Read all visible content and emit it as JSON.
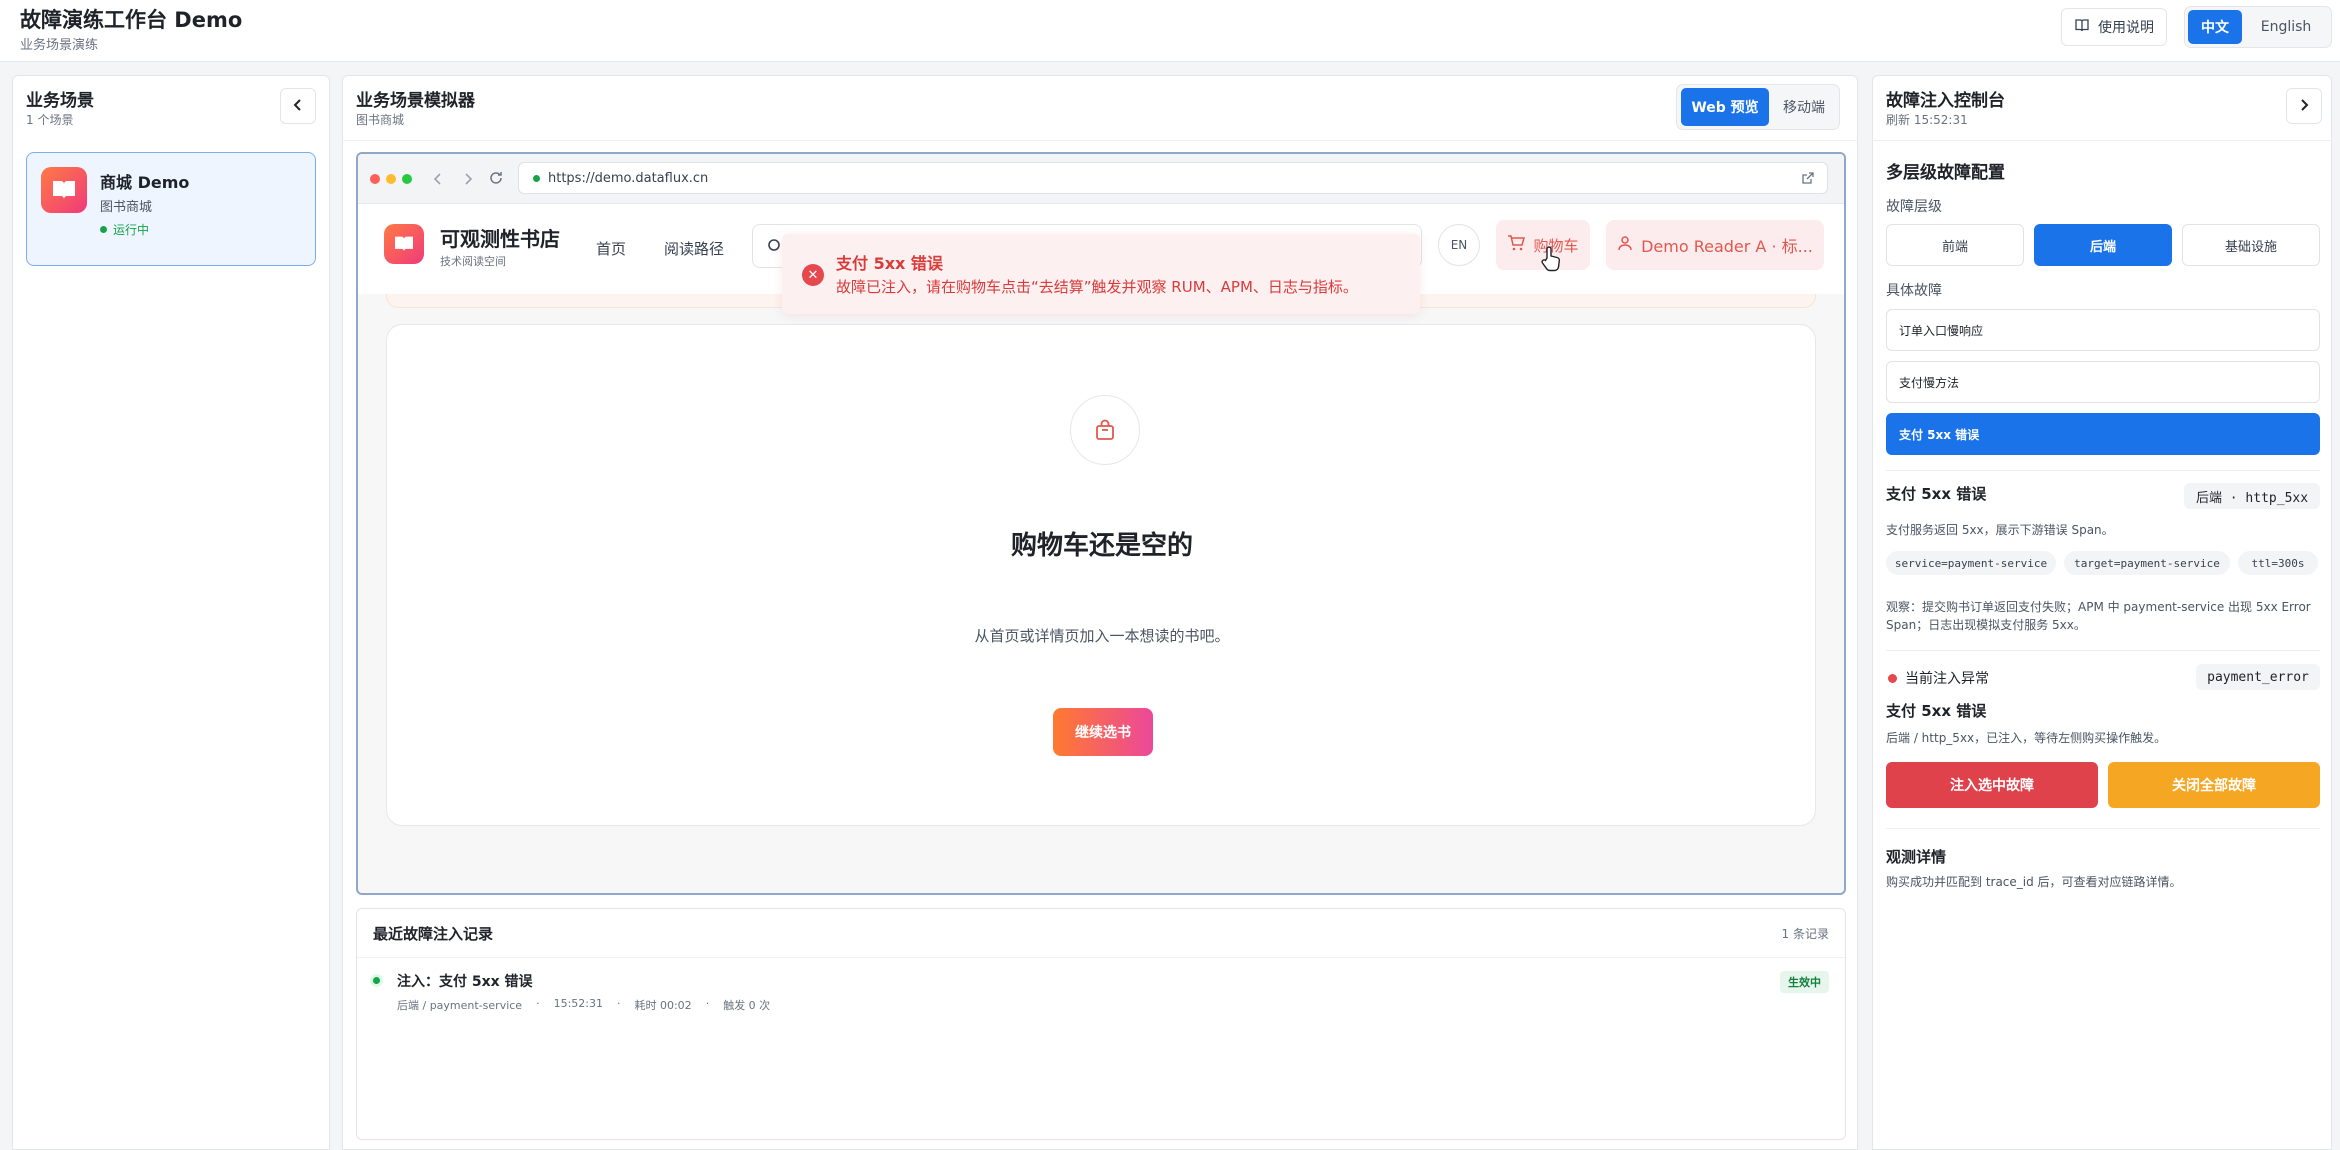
{
  "header": {
    "title": "故障演练工作台 Demo",
    "subtitle": "业务场景演练",
    "help_label": "使用说明",
    "lang_zh": "中文",
    "lang_en": "English"
  },
  "sidebar": {
    "title": "业务场景",
    "count": "1 个场景",
    "scenes": [
      {
        "name": "商城 Demo",
        "type": "图书商城",
        "status": "运行中",
        "status_color": "#16a34a"
      }
    ]
  },
  "simulator": {
    "title": "业务场景模拟器",
    "subtitle": "图书商城",
    "modes": [
      "Web 预览",
      "移动端"
    ],
    "url": "https://demo.dataflux.cn",
    "site": {
      "name": "可观测性书店",
      "tagline": "技术阅读空间",
      "nav": [
        "首页",
        "阅读路径"
      ],
      "lang_btn": "EN",
      "cart_label": "购物车",
      "user_label": "Demo Reader A · 标..."
    },
    "toast": {
      "title": "支付 5xx 错误",
      "message": "故障已注入，请在购物车点击“去结算”触发并观察 RUM、APM、日志与指标。"
    },
    "cart": {
      "empty_title": "购物车还是空的",
      "empty_sub": "从首页或详情页加入一本想读的书吧。",
      "continue_label": "继续选书"
    }
  },
  "records": {
    "title": "最近故障注入记录",
    "count": "1 条记录",
    "items": [
      {
        "name": "注入：支付 5xx 错误",
        "meta": [
          "后端 / payment-service",
          "·",
          "15:52:31",
          "·",
          "耗时 00:02",
          "·",
          "触发 0 次"
        ],
        "badge": "生效中"
      }
    ]
  },
  "console": {
    "title": "故障注入控制台",
    "refresh": "刷新 15:52:31",
    "config_title": "多层级故障配置",
    "layer_label": "故障层级",
    "layers": [
      "前端",
      "后端",
      "基础设施"
    ],
    "faults_label": "具体故障",
    "faults": [
      "订单入口慢响应",
      "支付慢方法",
      "支付 5xx 错误"
    ],
    "detail": {
      "name": "支付 5xx 错误",
      "code": "后端 · http_5xx",
      "desc": "支付服务返回 5xx，展示下游错误 Span。",
      "chips": [
        "service=payment-service",
        "target=payment-service",
        "ttl=300s"
      ],
      "observe": "观察：提交购书订单返回支付失败；APM 中 payment-service 出现 5xx Error Span；日志出现模拟支付服务 5xx。"
    },
    "current": {
      "label": "当前注入异常",
      "code": "payment_error",
      "name": "支付 5xx 错误",
      "desc": "后端 / http_5xx，已注入，等待左侧购买操作触发。",
      "dot_color": "#e5484d"
    },
    "inject_label": "注入选中故障",
    "close_all_label": "关闭全部故障",
    "observe_title": "观测详情",
    "observe_desc": "购买成功并匹配到 trace_id 后，可查看对应链路详情。"
  },
  "colors": {
    "accent": "#1a73e8",
    "danger": "#e5484d",
    "warning": "#f5a623",
    "success": "#16a34a"
  }
}
